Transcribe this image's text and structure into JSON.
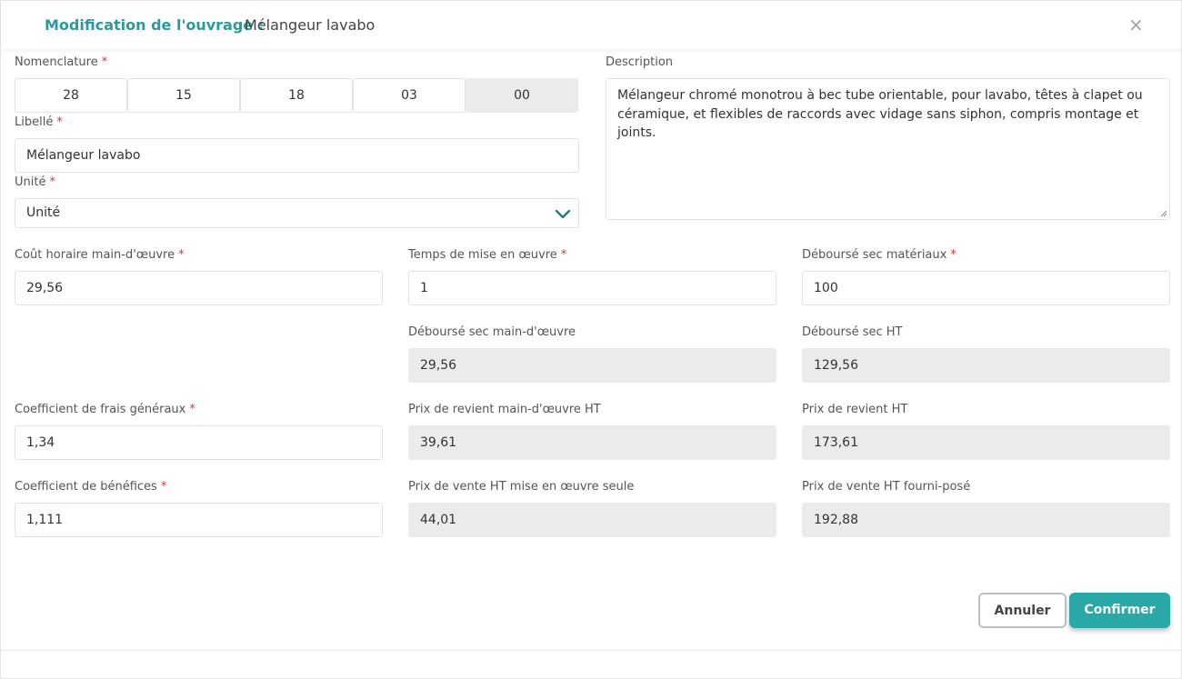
{
  "header": {
    "title_prefix": "Modification de l'ouvrage :",
    "title_name": "Mélangeur lavabo",
    "close_glyph": "×"
  },
  "nomenclature": {
    "label": "Nomenclature",
    "segments": [
      "28",
      "15",
      "18",
      "03",
      "00"
    ]
  },
  "libelle": {
    "label": "Libellé",
    "value": "Mélangeur lavabo"
  },
  "unite": {
    "label": "Unité",
    "value": "Unité"
  },
  "description": {
    "label": "Description",
    "value": "Mélangeur chromé monotrou à bec tube orientable, pour lavabo, têtes à clapet ou céramique, et flexibles de raccords avec vidage sans siphon, compris montage et joints."
  },
  "required_marker": "*",
  "fields": {
    "cout_horaire": {
      "label": "Coût horaire main-d'œuvre",
      "value": "29,56"
    },
    "temps_mise": {
      "label": "Temps de mise en œuvre",
      "value": "1"
    },
    "debourse_materiaux": {
      "label": "Déboursé sec matériaux",
      "value": "100"
    },
    "debourse_mo": {
      "label": "Déboursé sec main-d'œuvre",
      "value": "29,56"
    },
    "debourse_ht": {
      "label": "Déboursé sec HT",
      "value": "129,56"
    },
    "coef_frais": {
      "label": "Coefficient de frais généraux",
      "value": "1,34"
    },
    "prix_revient_mo": {
      "label": "Prix de revient main-d'œuvre HT",
      "value": "39,61"
    },
    "prix_revient_ht": {
      "label": "Prix de revient HT",
      "value": "173,61"
    },
    "coef_benefices": {
      "label": "Coefficient de bénéfices",
      "value": "1,111"
    },
    "prix_vente_seule": {
      "label": "Prix de vente HT mise en œuvre seule",
      "value": "44,01"
    },
    "prix_vente_fourni": {
      "label": "Prix de vente HT fourni-posé",
      "value": "192,88"
    }
  },
  "buttons": {
    "cancel": "Annuler",
    "confirm": "Confirmer"
  },
  "colors": {
    "accent": "#2aa7a7",
    "title": "#2a9a9a",
    "required": "#dd3333",
    "readonly_bg": "#ebebed"
  }
}
